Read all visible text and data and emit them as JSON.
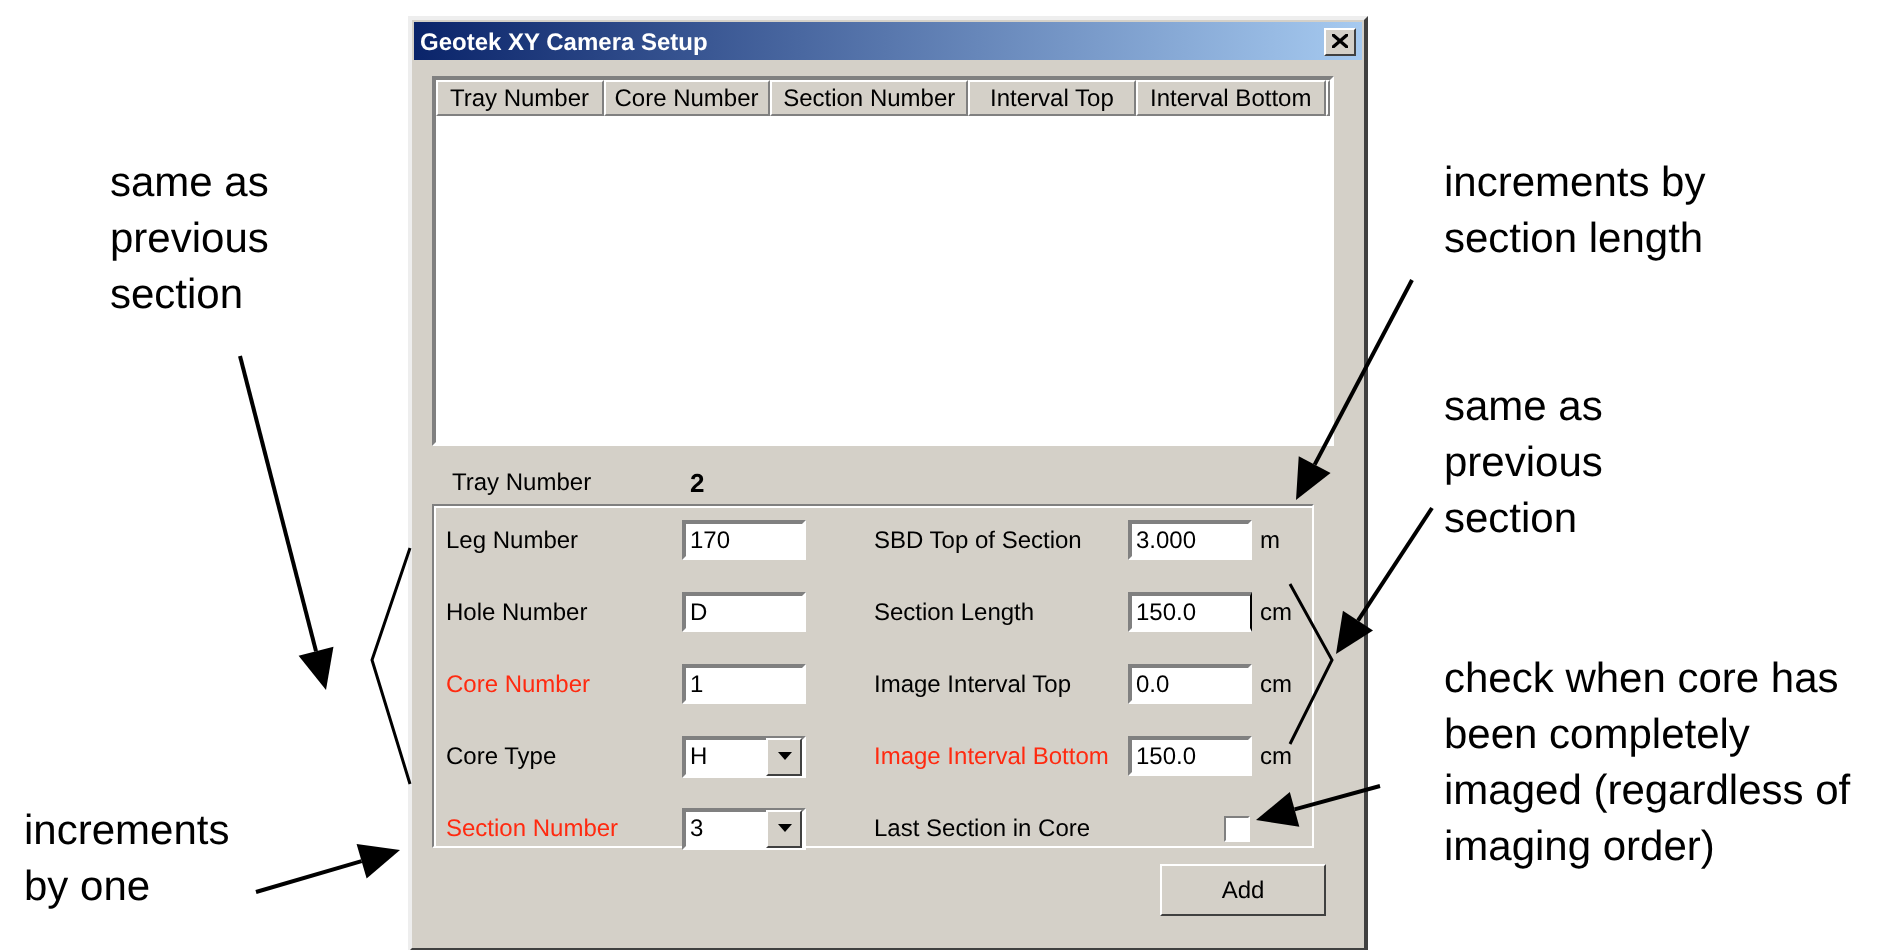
{
  "window": {
    "title": "Geotek XY Camera Setup"
  },
  "list": {
    "columns": [
      "Tray Number",
      "Core Number",
      "Section Number",
      "Interval Top",
      "Interval Bottom"
    ]
  },
  "tray": {
    "label": "Tray Number",
    "value": "2"
  },
  "left_fields": [
    {
      "label": "Leg Number",
      "highlighted": false,
      "kind": "text",
      "value": "170"
    },
    {
      "label": "Hole Number",
      "highlighted": false,
      "kind": "text",
      "value": "D"
    },
    {
      "label": "Core Number",
      "highlighted": true,
      "kind": "text",
      "value": "1"
    },
    {
      "label": "Core Type",
      "highlighted": false,
      "kind": "dropdown",
      "value": "H"
    },
    {
      "label": "Section Number",
      "highlighted": true,
      "kind": "dropdown",
      "value": "3"
    }
  ],
  "right_fields": [
    {
      "label": "SBD Top of Section",
      "highlighted": false,
      "kind": "text",
      "value": "3.000",
      "unit": "m"
    },
    {
      "label": "Section Length",
      "highlighted": false,
      "kind": "text",
      "value": "150.0",
      "unit": "cm",
      "focused": true
    },
    {
      "label": "Image Interval Top",
      "highlighted": false,
      "kind": "text",
      "value": "0.0",
      "unit": "cm"
    },
    {
      "label": "Image Interval Bottom",
      "highlighted": true,
      "kind": "text",
      "value": "150.0",
      "unit": "cm"
    },
    {
      "label": "Last Section in Core",
      "highlighted": false,
      "kind": "checkbox",
      "checked": false
    }
  ],
  "add_button": "Add",
  "annotations": [
    {
      "text": "same as previous section"
    },
    {
      "text": "increments by one"
    },
    {
      "text": "increments by section length"
    },
    {
      "text": "same as previous section"
    },
    {
      "text": "check when core has been completely imaged (regardless of imaging order)"
    }
  ]
}
